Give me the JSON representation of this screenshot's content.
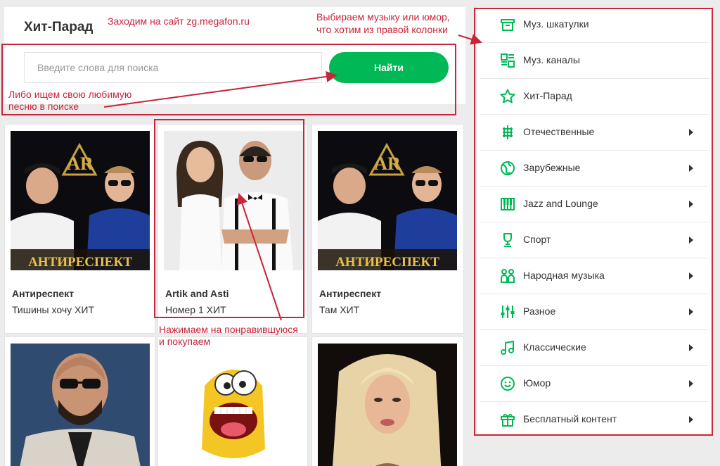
{
  "header": {
    "title": "Хит-Парад",
    "search_placeholder": "Введите слова для поиска",
    "search_button": "Найти"
  },
  "cards": [
    {
      "artist": "Антиреспект",
      "track": "Тишины хочу ХИТ",
      "cover_text": "АНТИРЕСПЕКТ",
      "logo": "AR"
    },
    {
      "artist": "Artik and Asti",
      "track": "Номер 1 ХИТ"
    },
    {
      "artist": "Антиреспект",
      "track": "Там ХИТ",
      "cover_text": "АНТИРЕСПЕКТ",
      "logo": "AR"
    }
  ],
  "sidebar": {
    "items": [
      {
        "label": "Муз. шкатулки",
        "icon": "music-box-icon",
        "chevron": false
      },
      {
        "label": "Муз. каналы",
        "icon": "channels-icon",
        "chevron": false
      },
      {
        "label": "Хит-Парад",
        "icon": "star-icon",
        "chevron": false
      },
      {
        "label": "Отечественные",
        "icon": "domestic-icon",
        "chevron": true
      },
      {
        "label": "Зарубежные",
        "icon": "globe-icon",
        "chevron": true
      },
      {
        "label": "Jazz and Lounge",
        "icon": "piano-icon",
        "chevron": true
      },
      {
        "label": "Спорт",
        "icon": "trophy-icon",
        "chevron": true
      },
      {
        "label": "Народная музыка",
        "icon": "folk-icon",
        "chevron": true
      },
      {
        "label": "Разное",
        "icon": "equalizer-icon",
        "chevron": true
      },
      {
        "label": "Классические",
        "icon": "music-note-icon",
        "chevron": true
      },
      {
        "label": "Юмор",
        "icon": "smile-icon",
        "chevron": true
      },
      {
        "label": "Бесплатный контент",
        "icon": "gift-icon",
        "chevron": true
      }
    ]
  },
  "annotations": {
    "site": "Заходим на сайт zg.megafon.ru",
    "choose_line1": "Выбираем музыку или юмор,",
    "choose_line2": "что хотим из правой колонки",
    "search_line1": "Либо ищем свою любимую",
    "search_line2": "песню в поиске",
    "buy_line1": "Нажимаем на понравившуюся",
    "buy_line2": "и покупаем"
  },
  "colors": {
    "accent": "#00b956",
    "annotation": "#c8243a"
  }
}
